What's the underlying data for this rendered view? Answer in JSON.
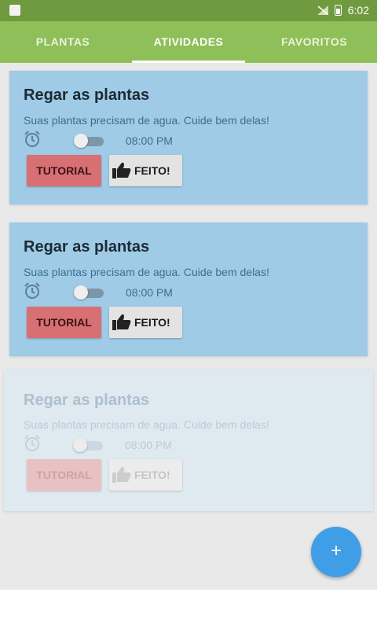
{
  "status_bar": {
    "time": "6:02",
    "colors": {
      "background": "#6f9a3f"
    }
  },
  "tabs": [
    {
      "label": "PLANTAS",
      "active": false
    },
    {
      "label": "ATIVIDADES",
      "active": true
    },
    {
      "label": "FAVORITOS",
      "active": false
    }
  ],
  "cards": [
    {
      "title": "Regar as plantas",
      "description": "Suas plantas precisam de agua. Cuide bem delas!",
      "time": "08:00 PM",
      "tutorial_label": "TUTORIAL",
      "done_label": "FEITO!",
      "alarm_enabled": false
    },
    {
      "title": "Regar as plantas",
      "description": "Suas plantas precisam de agua. Cuide bem delas!",
      "time": "08:00 PM",
      "tutorial_label": "TUTORIAL",
      "done_label": "FEITO!",
      "alarm_enabled": false
    },
    {
      "title": "Regar as plantas",
      "description": "Suas plantas precisam de agua. Cuide bem delas!",
      "time": "08:00 PM",
      "tutorial_label": "TUTORIAL",
      "done_label": "FEITO!",
      "alarm_enabled": false
    }
  ],
  "fab": {
    "label": "+",
    "icon": "plus-icon"
  },
  "colors": {
    "tab_bar": "#8fbf58",
    "card": "#9fcbe7",
    "tutorial_button": "#d86f73",
    "done_button": "#e3e3e3",
    "fab": "#3f9ee6"
  }
}
